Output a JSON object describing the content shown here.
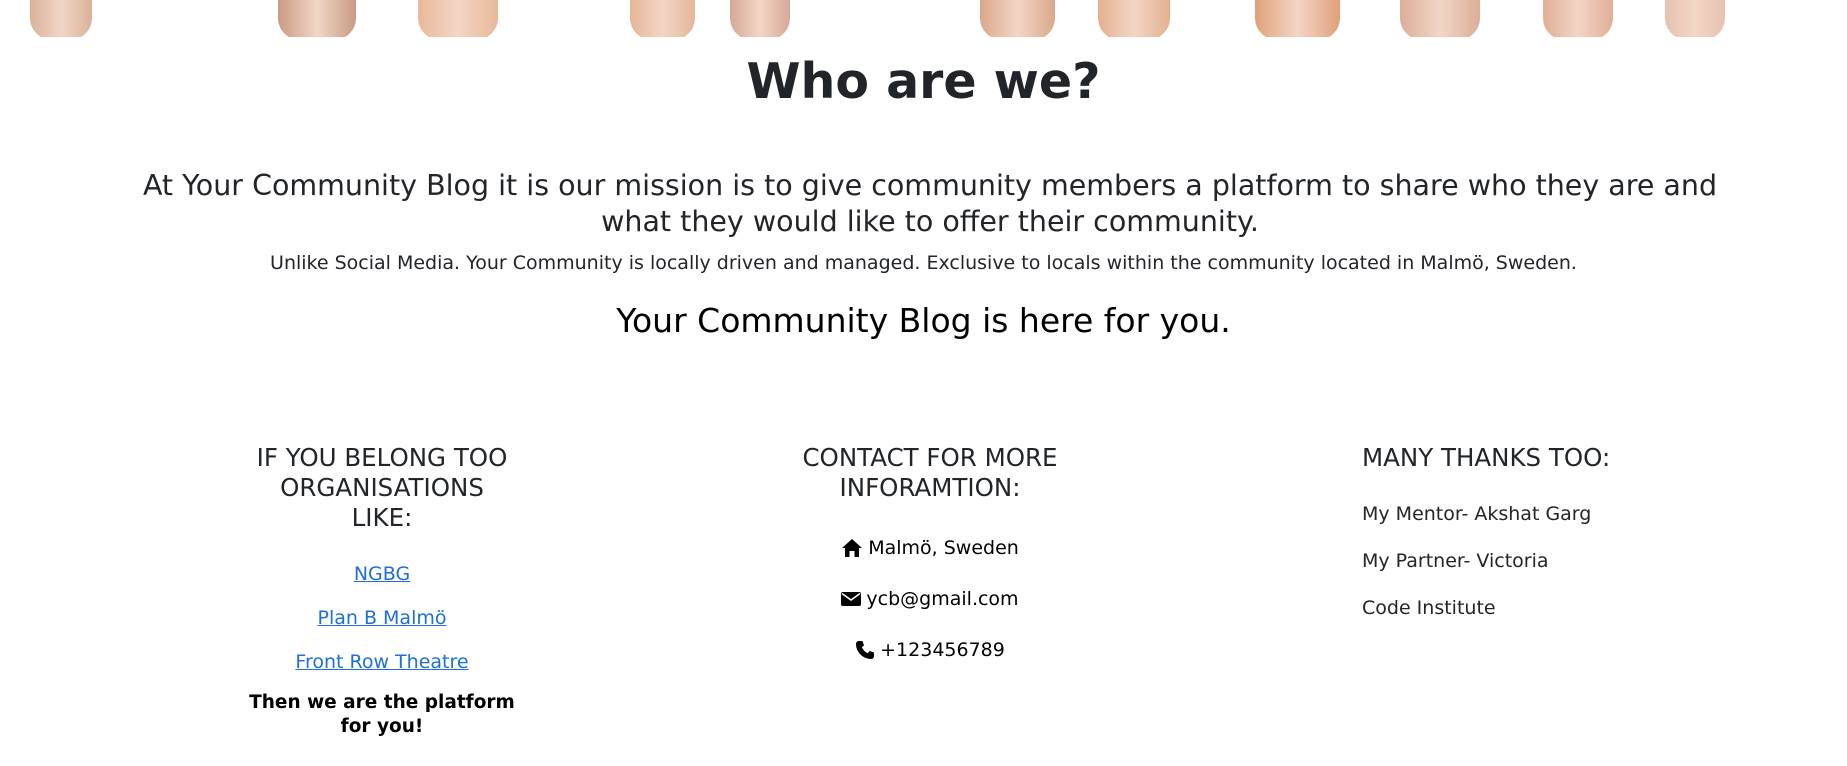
{
  "hero": {
    "hand_colors": [
      "#d9b29a",
      "#c99a83",
      "#e8b898",
      "#e5b598",
      "#d6a896",
      "#d9a88a",
      "#e3b08e",
      "#e0a07a",
      "#dcae98",
      "#e2ad96",
      "#e6c2b0"
    ]
  },
  "about": {
    "title": "Who are we?",
    "mission": "At Your Community Blog it is our mission is to give community members a platform to share who they are and what they would like to offer their community.",
    "unlike": "Unlike Social Media. Your Community is locally driven and managed. Exclusive to locals within the community located in Malmö, Sweden.",
    "tagline": "Your Community Blog is here for you."
  },
  "footer": {
    "organisations": {
      "heading_line1": "IF YOU BELONG TOO",
      "heading_line2": "ORGANISATIONS",
      "heading_line3": "LIKE:",
      "links": [
        "NGBG",
        "Plan B Malmö",
        "Front Row Theatre"
      ],
      "closing_line1": "Then we are the platform",
      "closing_line2": "for you!"
    },
    "contact": {
      "heading_line1": "CONTACT FOR MORE",
      "heading_line2": "INFORAMTION:",
      "location": "Malmö, Sweden",
      "email": "ycb@gmail.com",
      "phone": "+123456789",
      "icons": [
        "home-icon",
        "envelope-icon",
        "phone-icon"
      ]
    },
    "thanks": {
      "heading": "MANY THANKS TOO:",
      "items": [
        "My Mentor- Akshat Garg",
        "My Partner- Victoria",
        "Code Institute"
      ]
    }
  },
  "colors": {
    "link": "#1e6fd9",
    "text": "#212529"
  }
}
